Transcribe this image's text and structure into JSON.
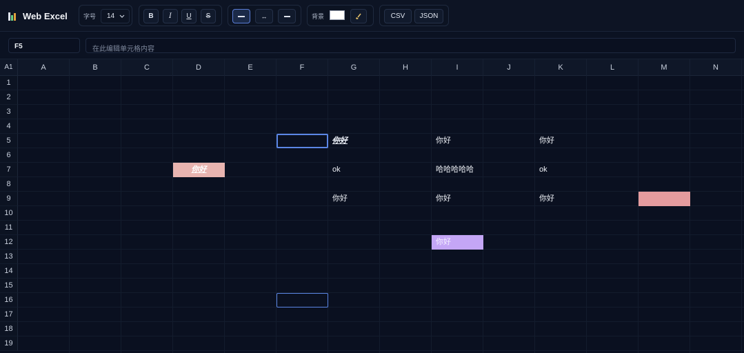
{
  "app": {
    "title": "Web Excel"
  },
  "toolbar": {
    "font_size_label": "字号",
    "font_size_value": "14",
    "bold_label": "B",
    "italic_label": "I",
    "underline_label": "U",
    "strike_label": "S",
    "bg_label": "背景",
    "bg_color": "#ffffff",
    "csv_label": "CSV",
    "json_label": "JSON"
  },
  "formula_bar": {
    "cell_ref": "F5",
    "placeholder": "在此编辑单元格内容"
  },
  "grid": {
    "corner_label": "A1",
    "columns": [
      "A",
      "B",
      "C",
      "D",
      "E",
      "F",
      "G",
      "H",
      "I",
      "J",
      "K",
      "L",
      "M",
      "N"
    ],
    "rows": [
      "1",
      "2",
      "3",
      "4",
      "5",
      "6",
      "7",
      "8",
      "9",
      "10",
      "11",
      "12",
      "13",
      "14",
      "15",
      "16",
      "17",
      "18",
      "19"
    ],
    "cells": [
      {
        "ref": "G5",
        "text": "你好",
        "bold": true,
        "italic": true,
        "underline": true,
        "strike": true,
        "bg": "",
        "color": "#e8ecf4"
      },
      {
        "ref": "I5",
        "text": "你好",
        "bg": "",
        "color": "#eef1f6"
      },
      {
        "ref": "K5",
        "text": "你好",
        "bg": "",
        "color": "#eef1f6"
      },
      {
        "ref": "D7",
        "text": "你好",
        "bold": true,
        "italic": true,
        "underline": true,
        "bg": "#e8b4b0",
        "color": "#ffffff"
      },
      {
        "ref": "G7",
        "text": "ok",
        "bg": "",
        "color": "#eef1f6"
      },
      {
        "ref": "I7",
        "text": "哈哈哈哈哈",
        "bg": "",
        "color": "#eef1f6"
      },
      {
        "ref": "K7",
        "text": "ok",
        "bg": "",
        "color": "#eef1f6"
      },
      {
        "ref": "G9",
        "text": "你好",
        "bg": "",
        "color": "#eef1f6"
      },
      {
        "ref": "I9",
        "text": "你好",
        "bg": "",
        "color": "#eef1f6"
      },
      {
        "ref": "K9",
        "text": "你好",
        "bg": "",
        "color": "#eef1f6"
      },
      {
        "ref": "M9",
        "text": "",
        "bg": "#e49b9e",
        "color": "#ffffff"
      },
      {
        "ref": "I12",
        "text": "你好",
        "bg": "#c4a6f6",
        "color": "#f4f0ff"
      }
    ],
    "selected": [
      "F5",
      "F16"
    ],
    "accent": "#5b86e5"
  }
}
